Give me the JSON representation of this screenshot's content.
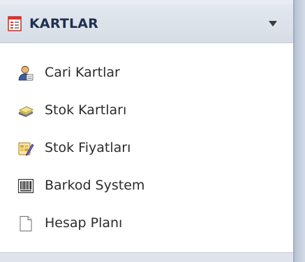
{
  "section": {
    "title": "KARTLAR",
    "icon": "list-document-icon",
    "expanded": true,
    "chevron_icon": "chevron-down-icon"
  },
  "items": [
    {
      "label": "Cari Kartlar",
      "icon": "user-card-icon"
    },
    {
      "label": "Stok Kartları",
      "icon": "stock-stack-icon"
    },
    {
      "label": "Stok Fiyatları",
      "icon": "price-edit-icon"
    },
    {
      "label": "Barkod System",
      "icon": "barcode-icon"
    },
    {
      "label": "Hesap Planı",
      "icon": "blank-page-icon"
    }
  ],
  "colors": {
    "header_bg": "#dbe1e9",
    "header_text": "#1f2f4f",
    "item_text": "#2b2b2b",
    "accent_red": "#d9342b"
  }
}
